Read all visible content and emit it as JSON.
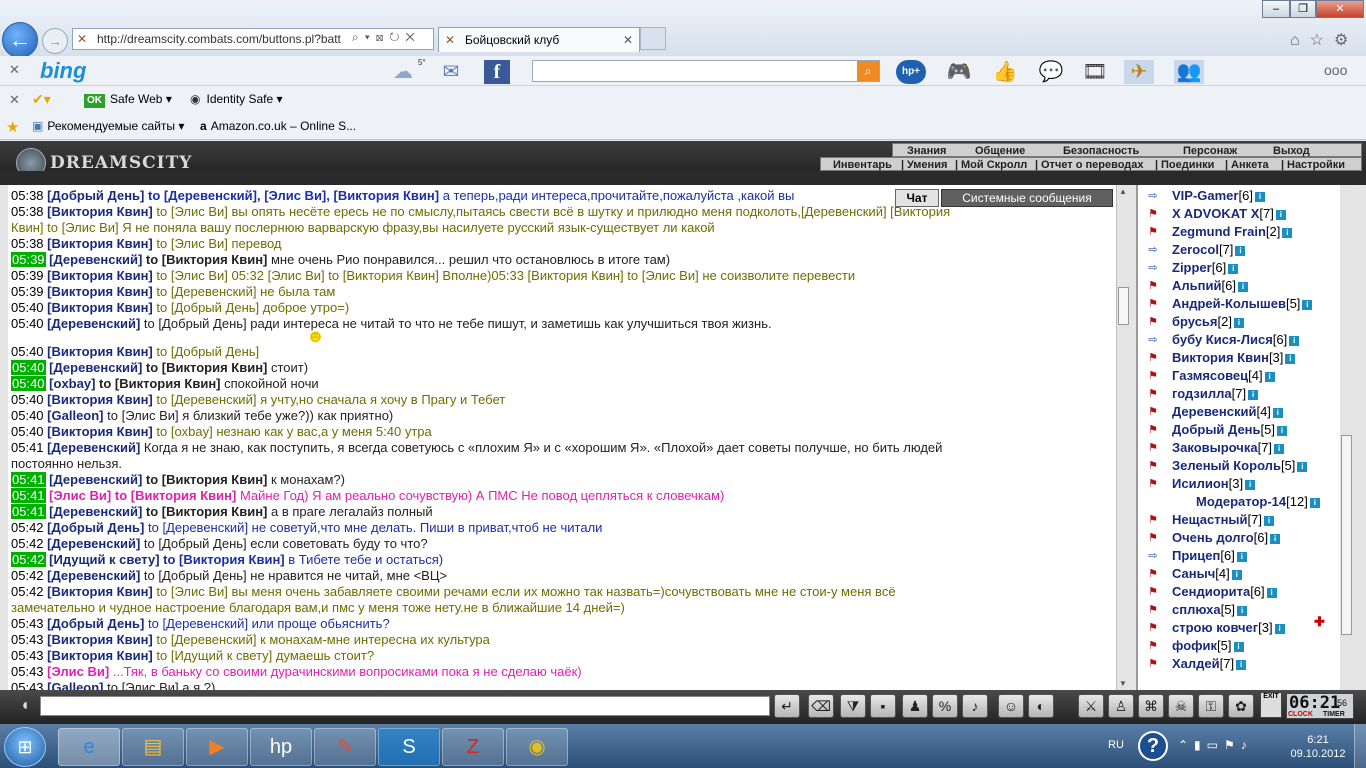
{
  "browser": {
    "url": "http://dreamscity.combats.com/buttons.pl?batt",
    "tab_title": "Бойцовский клуб",
    "tab_close": "✕",
    "back_icon": "←",
    "forward_icon": "→"
  },
  "bing": {
    "logo": "bing",
    "weather": "5°",
    "hp_label": "hp+",
    "search_value": ""
  },
  "favorites": {
    "safeweb": "Safe Web",
    "identity": "Identity Safe",
    "recommended": "Рекомендуемые сайты",
    "amazon": "Amazon.co.uk – Online S..."
  },
  "game": {
    "logo": "DREAMSCITY",
    "menu_top": [
      "Знания",
      "Общение",
      "Безопасность",
      "Персонаж",
      "Выход"
    ],
    "menu_bottom": [
      "Инвентарь",
      "Умения",
      "Мой Скролл",
      "Отчет о переводах",
      "Поединки",
      "Анкета",
      "Настройки"
    ],
    "menu_sep": "|",
    "tab_chat": "Чат",
    "tab_system": "Системные сообщения"
  },
  "chat": [
    {
      "time": "05:38",
      "hl": false,
      "nick": "[Добрый День]",
      "to": "to [Деревенский], [Элис Ви], [Виктория Квин]",
      "tobold": true,
      "text": " а теперь,ради интереса,прочитайте,пожалуйста ,какой вы",
      "color": "c-blue",
      "nickdark": false
    },
    {
      "time": "05:38",
      "hl": false,
      "nick": "[Виктория Квин]",
      "to": "to [Элис Ви]",
      "tobold": false,
      "text": " вы опять несёте ересь не по смыслу,пытаясь свести всё в шутку и прилюдно меня подколоть,[Деревенский] [Виктория",
      "color": "c-olive",
      "nickdark": false
    },
    {
      "time": "",
      "hl": false,
      "nick": "",
      "to": "",
      "tobold": false,
      "text": "Квин] to [Элис Ви] Я не поняла вашу послернюю варварскую фразу,вы насилуете русский язык-существует ли какой",
      "color": "c-olive",
      "nickdark": false
    },
    {
      "time": "05:38",
      "hl": false,
      "nick": "[Виктория Квин]",
      "to": "to [Элис Ви]",
      "tobold": false,
      "text": " перевод",
      "color": "c-olive",
      "nickdark": false
    },
    {
      "time": "05:39",
      "hl": true,
      "nick": "[Деревенский]",
      "to": "to [Виктория Квин]",
      "tobold": true,
      "text": " мне очень Рио понравился... решил что остановлюсь в итоге там)",
      "color": "c-black",
      "nickdark": false
    },
    {
      "time": "05:39",
      "hl": false,
      "nick": "[Виктория Квин]",
      "to": "to [Элис Ви]",
      "tobold": false,
      "text": " 05:32 [Элис Ви] to [Виктория Квин] Вполне)05:33 [Виктория Квин] to [Элис Ви] не соизволите перевести",
      "color": "c-olive",
      "nickdark": false
    },
    {
      "time": "05:39",
      "hl": false,
      "nick": "[Виктория Квин]",
      "to": "to [Деревенский]",
      "tobold": false,
      "text": " не была там",
      "color": "c-olive",
      "nickdark": false
    },
    {
      "time": "05:40",
      "hl": false,
      "nick": "[Виктория Квин]",
      "to": "to [Добрый День]",
      "tobold": false,
      "text": " доброе утро=)",
      "color": "c-olive",
      "nickdark": false
    },
    {
      "time": "05:40",
      "hl": false,
      "nick": "[Деревенский]",
      "to": "to [Добрый День]",
      "tobold": false,
      "text": " ради интереса не читай то что не тебе пишут, и заметишь как улучшиться твоя жизнь.",
      "color": "c-black",
      "nickdark": false
    },
    {
      "time": "05:40",
      "hl": false,
      "nick": "[Виктория Квин]",
      "to": "to [Добрый День]",
      "tobold": false,
      "text": "",
      "color": "c-olive",
      "nickdark": false
    },
    {
      "time": "05:40",
      "hl": true,
      "nick": "[Деревенский]",
      "to": "to [Виктория Квин]",
      "tobold": true,
      "text": " стоит)",
      "color": "c-black",
      "nickdark": false
    },
    {
      "time": "05:40",
      "hl": true,
      "nick": "[oxbay]",
      "to": "to [Виктория Квин]",
      "tobold": true,
      "text": " спокойной ночи",
      "color": "c-black",
      "nickdark": false
    },
    {
      "time": "05:40",
      "hl": false,
      "nick": "[Виктория Квин]",
      "to": "to [Деревенский]",
      "tobold": false,
      "text": " я учту,но сначала я хочу в Прагу и Тебет",
      "color": "c-olive",
      "nickdark": false
    },
    {
      "time": "05:40",
      "hl": false,
      "nick": "[Galleon]",
      "to": "to [Элис Ви]",
      "tobold": false,
      "text": " я близкий тебе уже?)) как приятно)",
      "color": "c-black",
      "nickdark": false
    },
    {
      "time": "05:40",
      "hl": false,
      "nick": "[Виктория Квин]",
      "to": "to [oxbay]",
      "tobold": false,
      "text": " незнаю как у вас,а у меня 5:40 утра",
      "color": "c-olive",
      "nickdark": false
    },
    {
      "time": "05:41",
      "hl": false,
      "nick": "[Деревенский]",
      "to": "",
      "tobold": false,
      "text": " Когда я не знаю, как поступить, я всегда советуюсь с «плохим Я» и с «хорошим Я». «Плохой» дает советы получше, но бить людей",
      "color": "c-black",
      "nickdark": false
    },
    {
      "time": "",
      "hl": false,
      "nick": "",
      "to": "",
      "tobold": false,
      "text": "постоянно нельзя.",
      "color": "c-black",
      "nickdark": false
    },
    {
      "time": "05:41",
      "hl": true,
      "nick": "[Деревенский]",
      "to": "to [Виктория Квин]",
      "tobold": true,
      "text": " к монахам?)",
      "color": "c-black",
      "nickdark": false
    },
    {
      "time": "05:41",
      "hl": true,
      "nick": "[Элис Ви]",
      "to": "to [Виктория Квин]",
      "tobold": true,
      "text": " Майне Год) Я ам реально сочувствую) А ПМС Не повод цепляться к словечкам)",
      "color": "c-magenta",
      "nickdark": false
    },
    {
      "time": "05:41",
      "hl": true,
      "nick": "[Деревенский]",
      "to": "to [Виктория Квин]",
      "tobold": true,
      "text": " а в праге легалайз полный",
      "color": "c-black",
      "nickdark": false
    },
    {
      "time": "05:42",
      "hl": false,
      "nick": "[Добрый День]",
      "to": "to [Деревенский]",
      "tobold": false,
      "text": " не советуй,что мне делать. Пиши в приват,чтоб не читали",
      "color": "c-blue",
      "nickdark": false
    },
    {
      "time": "05:42",
      "hl": false,
      "nick": "[Деревенский]",
      "to": "to [Добрый День]",
      "tobold": false,
      "text": " если советовать буду то что?",
      "color": "c-black",
      "nickdark": false
    },
    {
      "time": "05:42",
      "hl": true,
      "nick": "[Идущий к свету]",
      "to": "to [Виктория Квин]",
      "tobold": true,
      "text": " в Тибете тебе и остаться)",
      "color": "c-navy",
      "nickdark": false
    },
    {
      "time": "05:42",
      "hl": false,
      "nick": "[Деревенский]",
      "to": "to [Добрый День]",
      "tobold": false,
      "text": " не нравится не читай, мне <ВЦ>",
      "color": "c-black",
      "nickdark": false
    },
    {
      "time": "05:42",
      "hl": false,
      "nick": "[Виктория Квин]",
      "to": "to [Элис Ви]",
      "tobold": false,
      "text": " вы меня очень забавляете своими речами если их можно так назвать=)сочувствовать мне не стои-у меня всё",
      "color": "c-olive",
      "nickdark": false
    },
    {
      "time": "",
      "hl": false,
      "nick": "",
      "to": "",
      "tobold": false,
      "text": "замечательно и чудное настроение благодаря вам,и пмс у меня тоже нету.не в ближайшие 14 дней=)",
      "color": "c-olive",
      "nickdark": false
    },
    {
      "time": "05:43",
      "hl": false,
      "nick": "[Добрый День]",
      "to": "to [Деревенский]",
      "tobold": false,
      "text": " или проще обьяснить?",
      "color": "c-blue",
      "nickdark": false
    },
    {
      "time": "05:43",
      "hl": false,
      "nick": "[Виктория Квин]",
      "to": "to [Деревенский]",
      "tobold": false,
      "text": " к монахам-мне интересна их культура",
      "color": "c-olive",
      "nickdark": false
    },
    {
      "time": "05:43",
      "hl": false,
      "nick": "[Виктория Квин]",
      "to": "to [Идущий к свету]",
      "tobold": false,
      "text": " думаешь стоит?",
      "color": "c-olive",
      "nickdark": false
    },
    {
      "time": "05:43",
      "hl": false,
      "nick": "[Элис Ви]",
      "to": "",
      "tobold": false,
      "text": " ...Тяк, в баньку со своими дурачинскими вопросиками пока я не сделаю чаёк)",
      "color": "c-magenta",
      "nickdark": false
    },
    {
      "time": "05:43",
      "hl": false,
      "nick": "[Galleon]",
      "to": "to [Элис Ви]",
      "tobold": false,
      "text": " а я ?)",
      "color": "c-black",
      "nickdark": false
    }
  ],
  "users": [
    {
      "name": "VIP-Gamer",
      "level": "[6]"
    },
    {
      "name": "X ADVOKAT X",
      "level": "[7]"
    },
    {
      "name": "Zegmund Frain",
      "level": "[2]"
    },
    {
      "name": "Zerocol",
      "level": "[7]"
    },
    {
      "name": "Zipper",
      "level": "[6]"
    },
    {
      "name": "Альпий",
      "level": "[6]"
    },
    {
      "name": "Андрей-Колышев",
      "level": "[5]"
    },
    {
      "name": "брусья",
      "level": "[2]"
    },
    {
      "name": "бубу Кися-Лися",
      "level": "[6]"
    },
    {
      "name": "Виктория Квин",
      "level": "[3]"
    },
    {
      "name": "Газмясовец",
      "level": "[4]"
    },
    {
      "name": "годзилла",
      "level": "[7]"
    },
    {
      "name": "Деревенский",
      "level": "[4]"
    },
    {
      "name": "Добрый День",
      "level": "[5]"
    },
    {
      "name": "Заковырочка",
      "level": "[7]"
    },
    {
      "name": "Зеленый Король",
      "level": "[5]"
    },
    {
      "name": "Исилион",
      "level": "[3]"
    },
    {
      "name": "Модератор-14",
      "level": "[12]"
    },
    {
      "name": "Нещастный",
      "level": "[7]"
    },
    {
      "name": "Очень долго",
      "level": "[6]"
    },
    {
      "name": "Прицеп",
      "level": "[6]"
    },
    {
      "name": "Саныч",
      "level": "[4]"
    },
    {
      "name": "Сендиорита",
      "level": "[6]"
    },
    {
      "name": "сплюха",
      "level": "[5]"
    },
    {
      "name": "строю ковчег",
      "level": "[3]"
    },
    {
      "name": "фофик",
      "level": "[5]"
    },
    {
      "name": "Халдей",
      "level": "[7]"
    }
  ],
  "clock": {
    "time": "06:21",
    "sec": "56",
    "label1": "CLOCK",
    "label2": "TIMER",
    "exit": "EXIT"
  },
  "taskbar": {
    "lang": "RU",
    "time": "6:21",
    "date": "09.10.2012"
  }
}
